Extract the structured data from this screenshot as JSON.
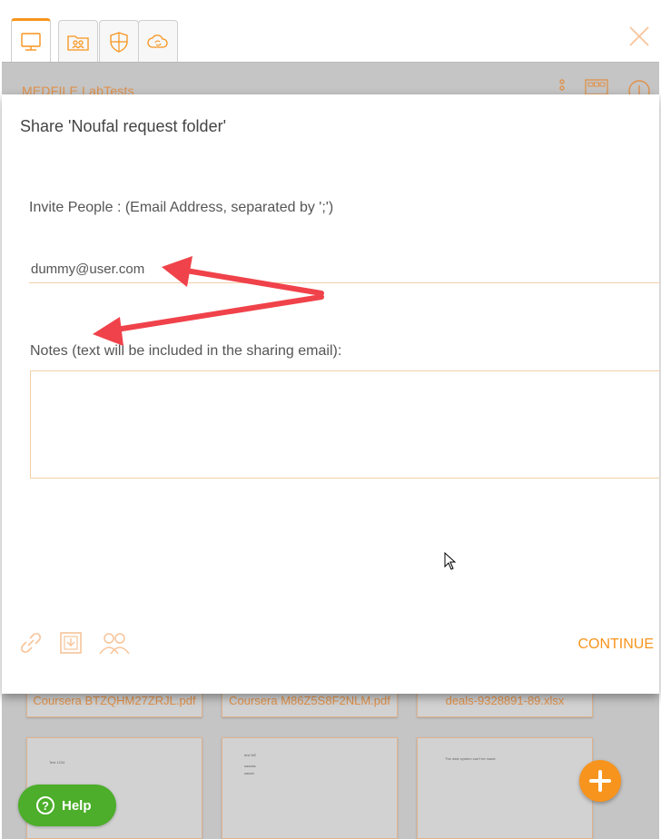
{
  "tabs": [
    {
      "icon": "computer-icon",
      "active": true
    },
    {
      "icon": "shared-folder-icon",
      "active": false
    },
    {
      "icon": "shield-icon",
      "active": false
    },
    {
      "icon": "cloud-sync-icon",
      "active": false
    }
  ],
  "background": {
    "title": "MEDFILE LabTests",
    "files": [
      {
        "name": "Coursera BTZQHM27ZRJL.pdf"
      },
      {
        "name": "Coursera M86Z5S8F2NLM.pdf"
      },
      {
        "name": "deals-9328891-89.xlsx"
      }
    ],
    "thumbs": [
      {
        "lines": [
          "Test 1234"
        ]
      },
      {
        "lines": [
          "test NE",
          "sasdas",
          "sasdd"
        ]
      },
      {
        "lines": [
          "The date system can't be made"
        ]
      }
    ]
  },
  "help": {
    "label": "Help",
    "symbol": "?"
  },
  "modal": {
    "title": "Share 'Noufal request folder'",
    "invite_label": "Invite People : (Email Address, separated by ';')",
    "email_value": "dummy@user.com",
    "notes_label": "Notes (text will be included in the sharing email):",
    "notes_value": "",
    "continue_label": "CONTINUE"
  },
  "colors": {
    "accent": "#f7941d",
    "help_green": "#4cae2a",
    "annotation_red": "#f0424a"
  }
}
